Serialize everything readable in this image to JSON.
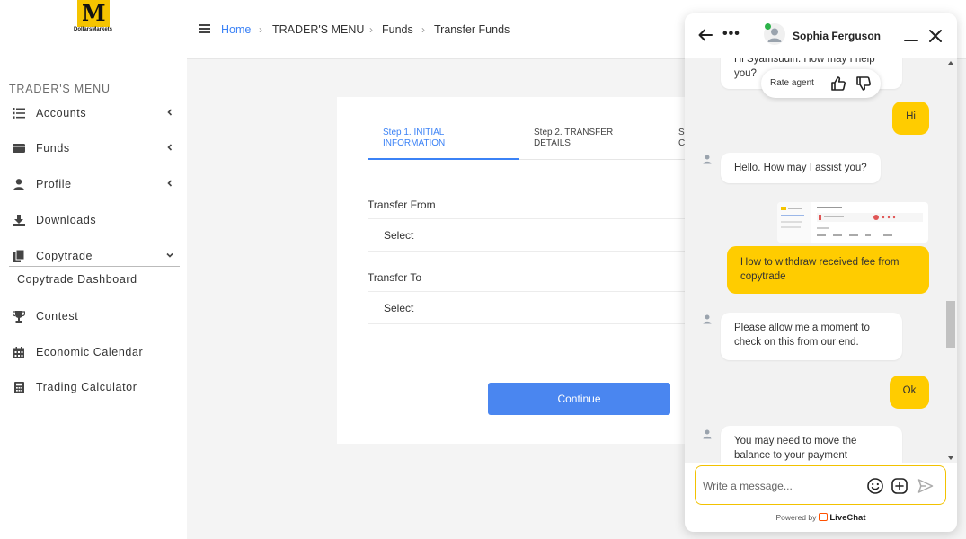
{
  "brand": {
    "logo_letter": "M",
    "logo_text": "DollarsMarkets",
    "accent": "#f5c400"
  },
  "sidebar": {
    "title": "TRADER'S MENU",
    "items": [
      {
        "label": "Accounts",
        "icon": "list-icon",
        "has_chevron": "left"
      },
      {
        "label": "Funds",
        "icon": "wallet-icon",
        "has_chevron": "left"
      },
      {
        "label": "Profile",
        "icon": "user-icon",
        "has_chevron": "left"
      },
      {
        "label": "Downloads",
        "icon": "download-icon"
      },
      {
        "label": "Copytrade",
        "icon": "copy-icon",
        "has_chevron": "down"
      },
      {
        "label": "Contest",
        "icon": "trophy-icon"
      },
      {
        "label": "Economic Calendar",
        "icon": "calendar-icon"
      },
      {
        "label": "Trading Calculator",
        "icon": "calculator-icon"
      }
    ],
    "submenu": {
      "label": "Copytrade Dashboard"
    }
  },
  "breadcrumb": {
    "home": "Home",
    "section": "TRADER'S MENU",
    "page": "Funds",
    "current": "Transfer Funds"
  },
  "form": {
    "steps": [
      {
        "line1": "Step 1. INITIAL",
        "line2": "INFORMATION",
        "active": true
      },
      {
        "line1": "Step 2. TRANSFER",
        "line2": "DETAILS",
        "active": false
      },
      {
        "line1": "S",
        "line2": "C",
        "active": false
      }
    ],
    "transfer_from_label": "Transfer From",
    "transfer_from_value": "Select",
    "transfer_to_label": "Transfer To",
    "transfer_to_value": "Select",
    "continue_label": "Continue",
    "primary_color": "#4a86f0"
  },
  "chat": {
    "agent_name": "Sophia Ferguson",
    "rate_label": "Rate agent",
    "messages": [
      {
        "from": "agent",
        "text_line1": "Hi Syamsudin. How may I help",
        "text_line2": "you?"
      },
      {
        "from": "user",
        "text": "Hi"
      },
      {
        "from": "agent",
        "text": "Hello. How may I assist you?"
      },
      {
        "from": "user",
        "text_line1": "How to withdraw received fee from",
        "text_line2": "copytrade"
      },
      {
        "from": "agent",
        "text_line1": "Please allow me a moment to",
        "text_line2": "check on this from our end."
      },
      {
        "from": "user",
        "text": "Ok"
      },
      {
        "from": "agent",
        "text_line1": "You may need to move the",
        "text_line2": "balance to your payment"
      }
    ],
    "input_placeholder": "Write a message...",
    "powered_by": "Powered by",
    "powered_brand": "LiveChat",
    "user_bubble_color": "#ffcc00"
  }
}
